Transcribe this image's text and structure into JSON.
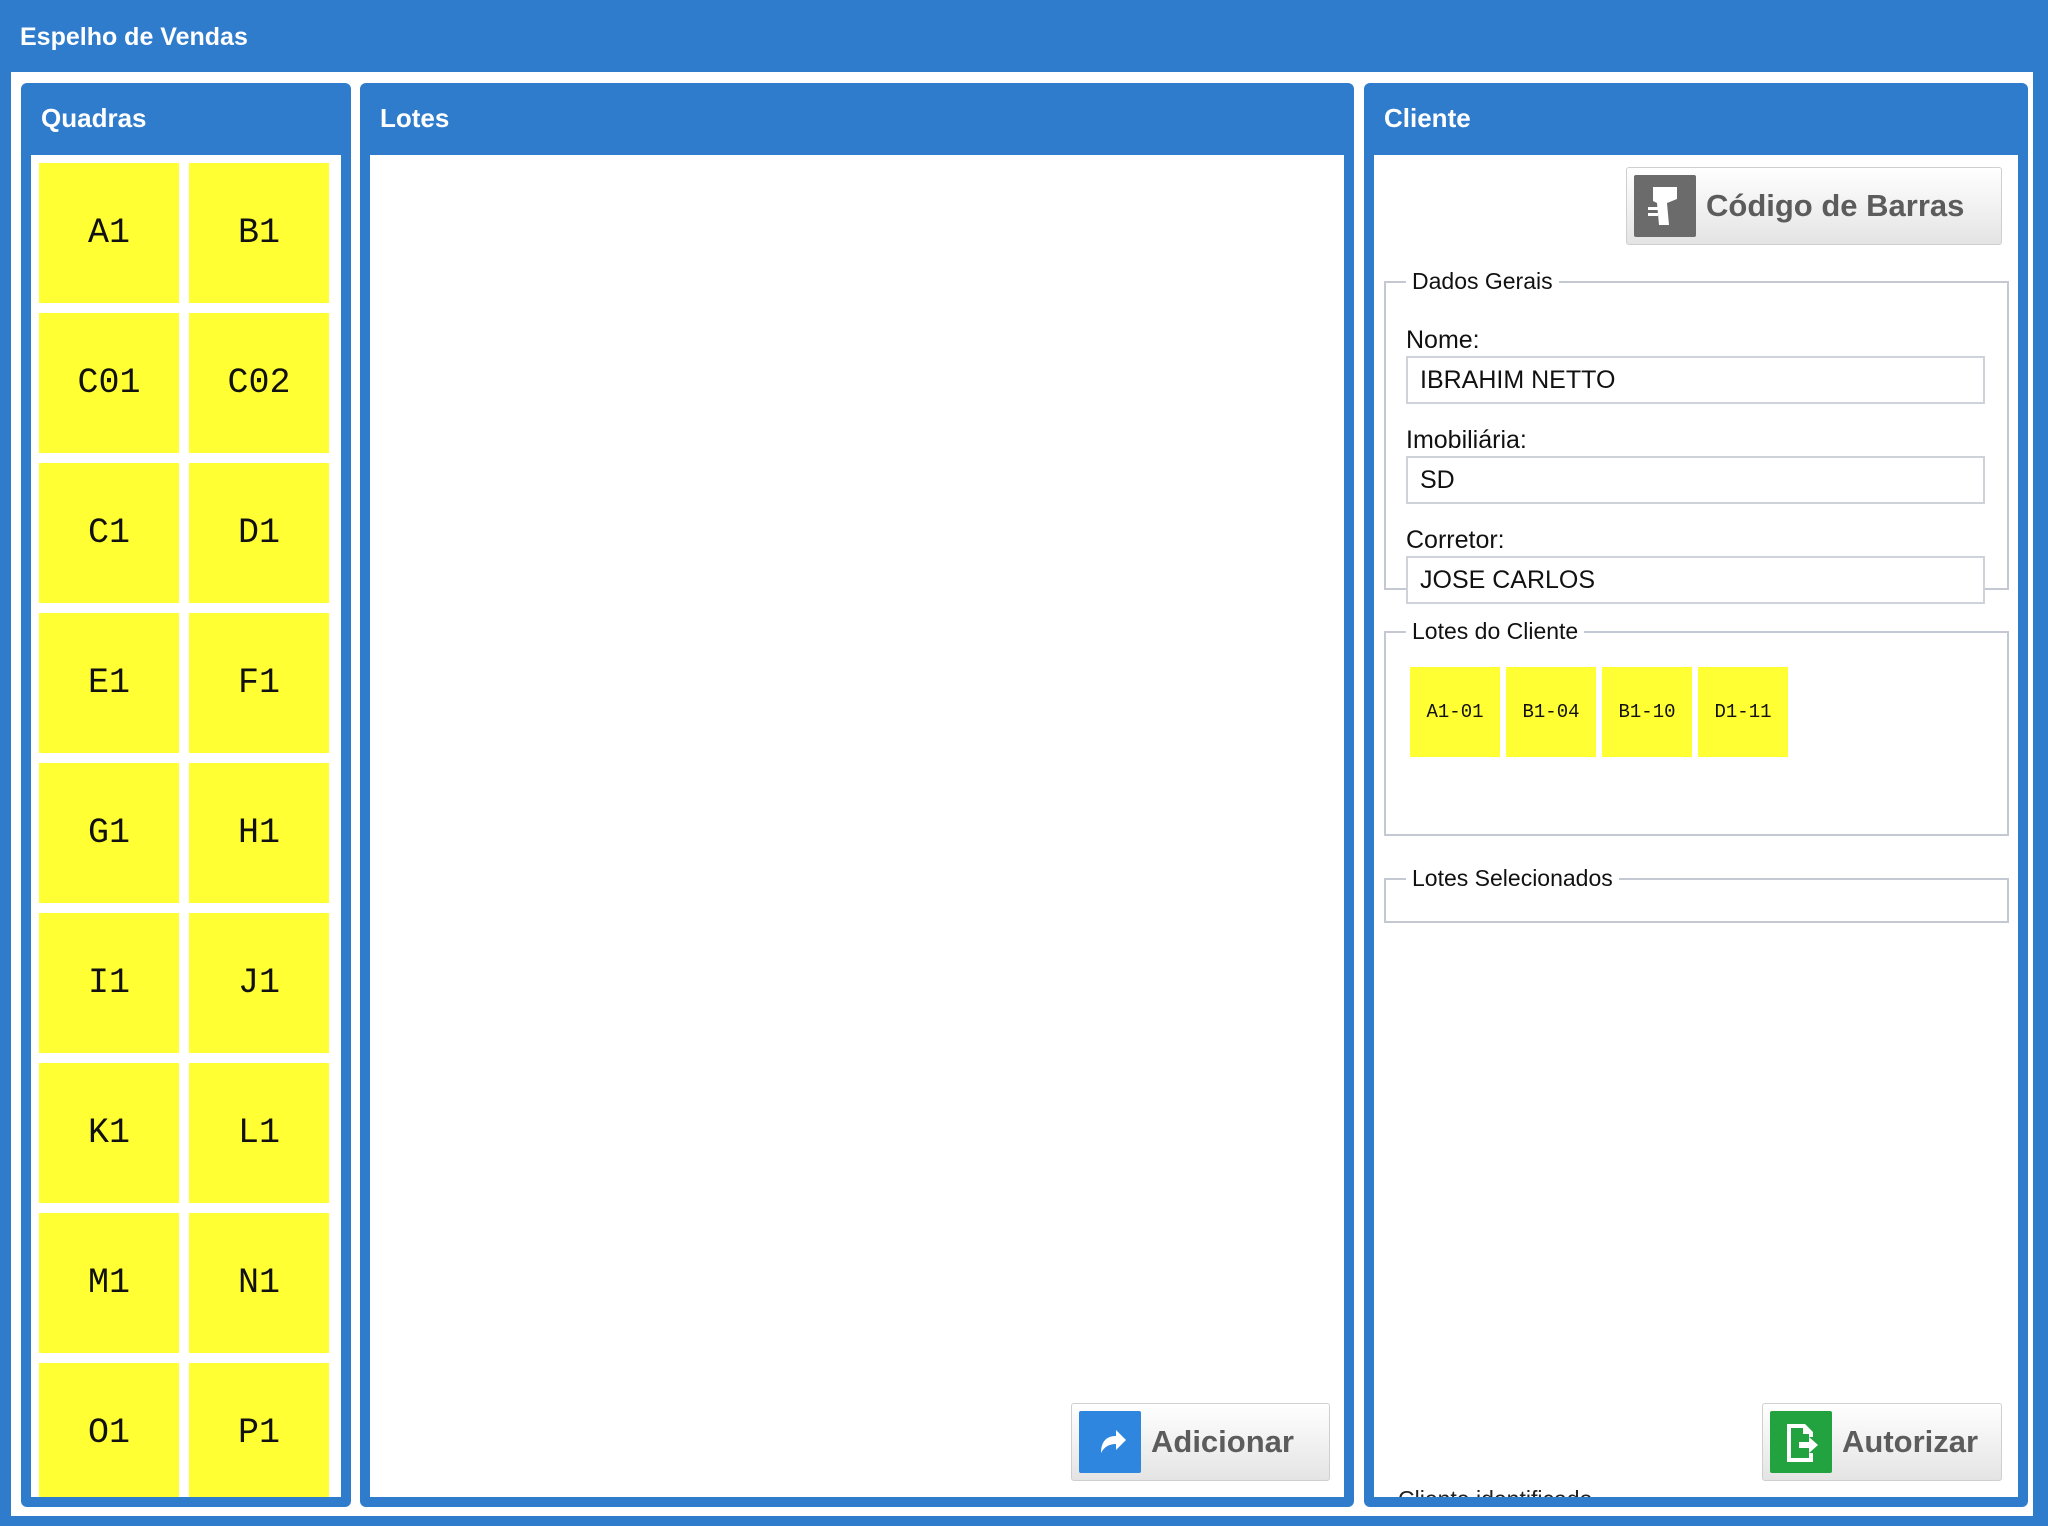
{
  "window": {
    "title": "Espelho de Vendas"
  },
  "quadras": {
    "title": "Quadras",
    "items": [
      "A1",
      "B1",
      "C01",
      "C02",
      "C1",
      "D1",
      "E1",
      "F1",
      "G1",
      "H1",
      "I1",
      "J1",
      "K1",
      "L1",
      "M1",
      "N1",
      "O1",
      "P1"
    ]
  },
  "lotes": {
    "title": "Lotes",
    "add_button": {
      "label": "Adicionar",
      "icon": "redo-arrow-icon",
      "icon_color": "#2f86de"
    }
  },
  "cliente": {
    "title": "Cliente",
    "barcode_button": {
      "label": "Código de Barras",
      "icon": "barcode-scanner-icon",
      "icon_color": "#6b6b6b"
    },
    "dados_gerais": {
      "legend": "Dados Gerais",
      "nome": {
        "label": "Nome:",
        "value": "IBRAHIM NETTO"
      },
      "imobiliaria": {
        "label": "Imobiliária:",
        "value": "SD"
      },
      "corretor": {
        "label": "Corretor:",
        "value": "JOSE CARLOS"
      }
    },
    "lotes_do_cliente": {
      "legend": "Lotes do Cliente",
      "items": [
        "A1-01",
        "B1-04",
        "B1-10",
        "D1-11"
      ]
    },
    "lotes_selecionados": {
      "legend": "Lotes Selecionados"
    },
    "status": "Cliente identificado.",
    "authorize_button": {
      "label": "Autorizar",
      "icon": "document-export-icon",
      "icon_color": "#23a340"
    }
  },
  "colors": {
    "header_blue": "#2f7ccc",
    "tile_yellow": "#ffff33"
  }
}
